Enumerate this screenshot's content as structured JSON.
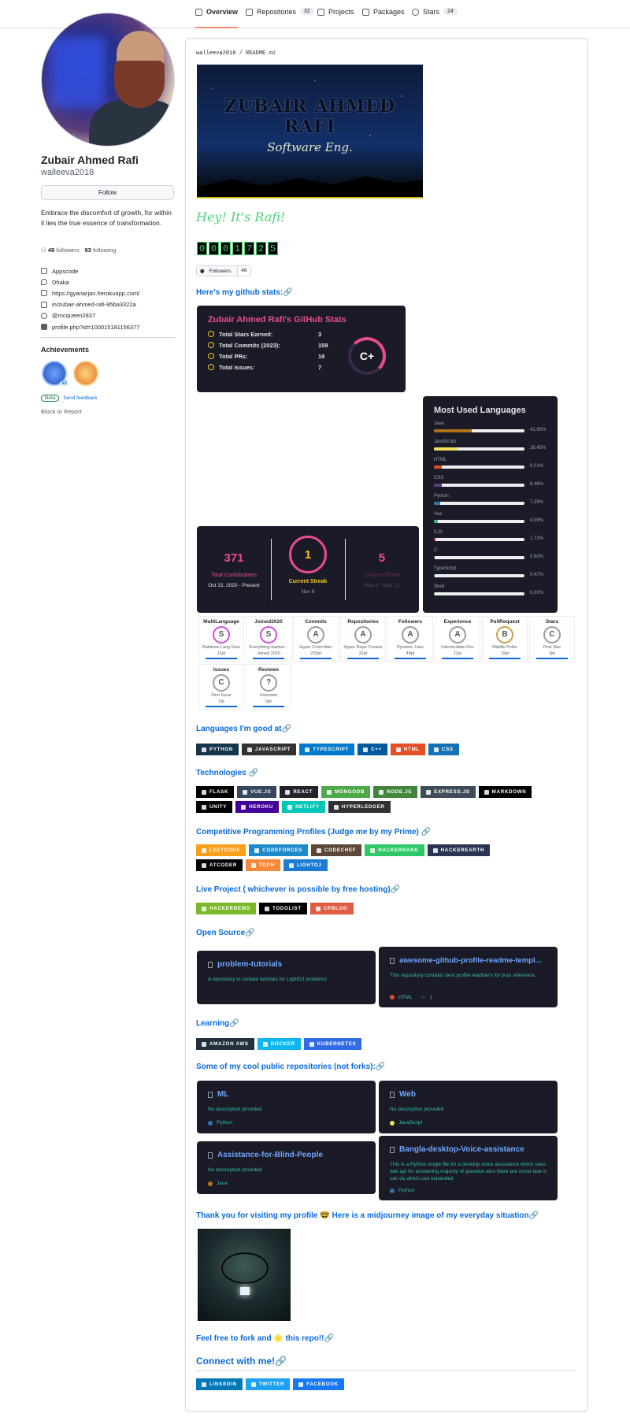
{
  "nav": {
    "tabs": [
      {
        "label": "Overview",
        "count": ""
      },
      {
        "label": "Repositories",
        "count": "32"
      },
      {
        "label": "Projects",
        "count": ""
      },
      {
        "label": "Packages",
        "count": ""
      },
      {
        "label": "Stars",
        "count": "24"
      }
    ]
  },
  "profile": {
    "name": "Zubair Ahmed Rafi",
    "login": "walleeva2018",
    "follow_label": "Follow",
    "bio": "Embrace the discomfort of growth, for within it lies the true essence of transformation.",
    "followers": "48",
    "followers_label": "followers",
    "following": "93",
    "following_label": "following",
    "details": [
      {
        "icon": "organization-icon",
        "text": "Appscode"
      },
      {
        "icon": "location-icon",
        "text": "Dhaka"
      },
      {
        "icon": "link-icon",
        "text": "https://gyanarjan.herokuapp.com/"
      },
      {
        "icon": "linkedin-icon",
        "text": "in/zubair-ahmed-rafi-95ba3322a"
      },
      {
        "icon": "twitter-icon",
        "text": "@mcqueen2837"
      },
      {
        "icon": "facebook-icon",
        "text": "profile.php?id=100015181156377"
      }
    ],
    "achievements_title": "Achievements",
    "achievement_count": "x2",
    "beta_label": "Beta",
    "feedback_label": "Send feedback",
    "block_label": "Block or Report"
  },
  "readme": {
    "path_user": "walleeva2018",
    "path_sep": " / ",
    "path_file": "README",
    "path_ext": ".md",
    "banner_title": "ZUBAIR AHMED RAFI",
    "banner_subtitle": "Software Eng.",
    "greeting": "Hey! It's Rafi!",
    "counter_digits": [
      "0",
      "0",
      "0",
      "1",
      "7",
      "2",
      "5"
    ],
    "followers_badge_label": "Followers",
    "followers_badge_value": "48",
    "stats_heading": "Here's my github stats:",
    "stats_card": {
      "title": "Zubair Ahmed Rafi's GitHub Stats",
      "rows": [
        {
          "label": "Total Stars Earned:",
          "value": "3"
        },
        {
          "label": "Total Commits (2023):",
          "value": "159"
        },
        {
          "label": "Total PRs:",
          "value": "19"
        },
        {
          "label": "Total Issues:",
          "value": "7"
        }
      ],
      "grade": "C+"
    },
    "languages_card": {
      "title": "Most Used Languages",
      "items": [
        {
          "name": "Java",
          "pct": "41.85%",
          "value": 41.85,
          "color": "#b07219"
        },
        {
          "name": "JavaScript",
          "pct": "26.45%",
          "value": 26.45,
          "color": "#f1e05a"
        },
        {
          "name": "HTML",
          "pct": "9.01%",
          "value": 9.01,
          "color": "#e34c26"
        },
        {
          "name": "CSS",
          "pct": "8.46%",
          "value": 8.46,
          "color": "#563d7c"
        },
        {
          "name": "Python",
          "pct": "7.29%",
          "value": 7.29,
          "color": "#3572A5"
        },
        {
          "name": "Vue",
          "pct": "4.09%",
          "value": 4.09,
          "color": "#41b883"
        },
        {
          "name": "EJS",
          "pct": "1.73%",
          "value": 1.73,
          "color": "#a91e50"
        },
        {
          "name": "C",
          "pct": "0.60%",
          "value": 0.6,
          "color": "#555555"
        },
        {
          "name": "TypeScript",
          "pct": "0.47%",
          "value": 0.47,
          "color": "#3178c6"
        },
        {
          "name": "Shell",
          "pct": "0.03%",
          "value": 0.03,
          "color": "#89e051"
        }
      ]
    },
    "streak_card": {
      "total": "371",
      "total_label": "Total Contributions",
      "total_range": "Oct 15, 2020 - Present",
      "current": "1",
      "current_label": "Current Streak",
      "current_date": "Nov 6",
      "longest": "5",
      "longest_label": "Longest Streak",
      "longest_range": "May 9 - May 13"
    },
    "trophies": [
      {
        "title": "MultiLanguage",
        "rank": "S",
        "sub": "Rainbow Lang User",
        "pts": "11pt"
      },
      {
        "title": "Joined2020",
        "rank": "S",
        "sub": "Everything started...",
        "pts": "Joined 2020"
      },
      {
        "title": "Commits",
        "rank": "A",
        "sub": "Hyper Committer",
        "pts": "225pt"
      },
      {
        "title": "Repositories",
        "rank": "A",
        "sub": "Hyper Repo Creator",
        "pts": "32pt"
      },
      {
        "title": "Followers",
        "rank": "A",
        "sub": "Dynamic User",
        "pts": "48pt"
      },
      {
        "title": "Experience",
        "rank": "A",
        "sub": "Intermediate Dev",
        "pts": "11pt"
      },
      {
        "title": "PullRequest",
        "rank": "B",
        "sub": "Middle Puller",
        "pts": "19pt"
      },
      {
        "title": "Stars",
        "rank": "C",
        "sub": "First Star",
        "pts": "3pt"
      },
      {
        "title": "Issues",
        "rank": "C",
        "sub": "First Issue",
        "pts": "7pt"
      },
      {
        "title": "Reviews",
        "rank": "?",
        "sub": "Unknown",
        "pts": "0pt"
      }
    ],
    "langs_heading": "Languages I'm good at",
    "langs_badges": [
      {
        "label": "PYTHON",
        "color": "#14354c"
      },
      {
        "label": "JAVASCRIPT",
        "color": "#323330"
      },
      {
        "label": "TYPESCRIPT",
        "color": "#007acc"
      },
      {
        "label": "C++",
        "color": "#00599c"
      },
      {
        "label": "HTML",
        "color": "#e34f26"
      },
      {
        "label": "CSS",
        "color": "#1572b6"
      }
    ],
    "tech_heading": "Technologies",
    "tech_badges": [
      {
        "label": "FLASK",
        "color": "#000000"
      },
      {
        "label": "VUE.JS",
        "color": "#35495e"
      },
      {
        "label": "REACT",
        "color": "#20232a"
      },
      {
        "label": "MONGODB",
        "color": "#4ea94b"
      },
      {
        "label": "NODE.JS",
        "color": "#43853d"
      },
      {
        "label": "EXPRESS.JS",
        "color": "#404d59"
      },
      {
        "label": "MARKDOWN",
        "color": "#000000"
      },
      {
        "label": "UNITY",
        "color": "#000000"
      },
      {
        "label": "HEROKU",
        "color": "#430098"
      },
      {
        "label": "NETLIFY",
        "color": "#00c7b7"
      },
      {
        "label": "HYPERLEDGER",
        "color": "#2f3134"
      }
    ],
    "cp_heading": "Competitive Programming Profiles (Judge me by my Prime)",
    "cp_badges": [
      {
        "label": "LEETCODE",
        "color": "#f89f1b"
      },
      {
        "label": "CODEFORCES",
        "color": "#1f8acb"
      },
      {
        "label": "CODECHEF",
        "color": "#5b4638"
      },
      {
        "label": "HACKERRANK",
        "color": "#2ec866"
      },
      {
        "label": "HACKEREARTH",
        "color": "#2c3454"
      },
      {
        "label": "ATCODER",
        "color": "#000000"
      },
      {
        "label": "TOPH",
        "color": "#f7893b"
      },
      {
        "label": "LIGHTOJ",
        "color": "#1c7bd3"
      }
    ],
    "live_heading": "Live Project ( whichever is possible by free hosting)",
    "live_badges": [
      {
        "label": "HACKERNEWS",
        "color": "#7cb928"
      },
      {
        "label": "TODOLIST",
        "color": "#000000"
      },
      {
        "label": "CPBLOG",
        "color": "#e05d44"
      }
    ],
    "oss_heading": "Open Source",
    "oss_repos": [
      {
        "name": "problem-tutorials",
        "desc": "A repository to contain tutorials for LightOJ problems",
        "lang": "",
        "lang_color": "",
        "stars": ""
      },
      {
        "name": "awesome-github-profile-readme-templ...",
        "desc": "This repository contains best profile readme's for your reference.",
        "lang": "HTML",
        "lang_color": "#e34c26",
        "stars": "1"
      }
    ],
    "learning_heading": "Learning",
    "learning_badges": [
      {
        "label": "AMAZON AWS",
        "color": "#232f3e"
      },
      {
        "label": "DOCKER",
        "color": "#0db7ed"
      },
      {
        "label": "KUBERNETES",
        "color": "#326ce5"
      }
    ],
    "cool_heading": "Some of my cool public repositories (not forks):",
    "cool_repos": [
      {
        "name": "ML",
        "desc": "No description provided",
        "lang": "Python",
        "lang_color": "#3572a5"
      },
      {
        "name": "Web",
        "desc": "No description provided",
        "lang": "JavaScript",
        "lang_color": "#f1e05a"
      },
      {
        "name": "Assistance-for-Blind-People",
        "desc": "No description provided",
        "lang": "Java",
        "lang_color": "#b07219"
      },
      {
        "name": "Bangla-desktop-Voice-assistance",
        "desc": "This is a Python single file for a desktop voice assistance which uses wiki api for answering majority of question also there are some task it can do which can expanded",
        "lang": "Python",
        "lang_color": "#3572a5"
      }
    ],
    "thanks_heading": "Thank you for visiting my profile 🤓 Here is a midjourney image of my everyday situation",
    "fork_text": "Feel free to fork and 🌟 this repo!!",
    "connect_heading": "Connect with me!",
    "connect_badges": [
      {
        "label": "LINKEDIN",
        "color": "#0077b5"
      },
      {
        "label": "TWITTER",
        "color": "#1da1f2"
      },
      {
        "label": "FACEBOOK",
        "color": "#1877f2"
      }
    ]
  }
}
